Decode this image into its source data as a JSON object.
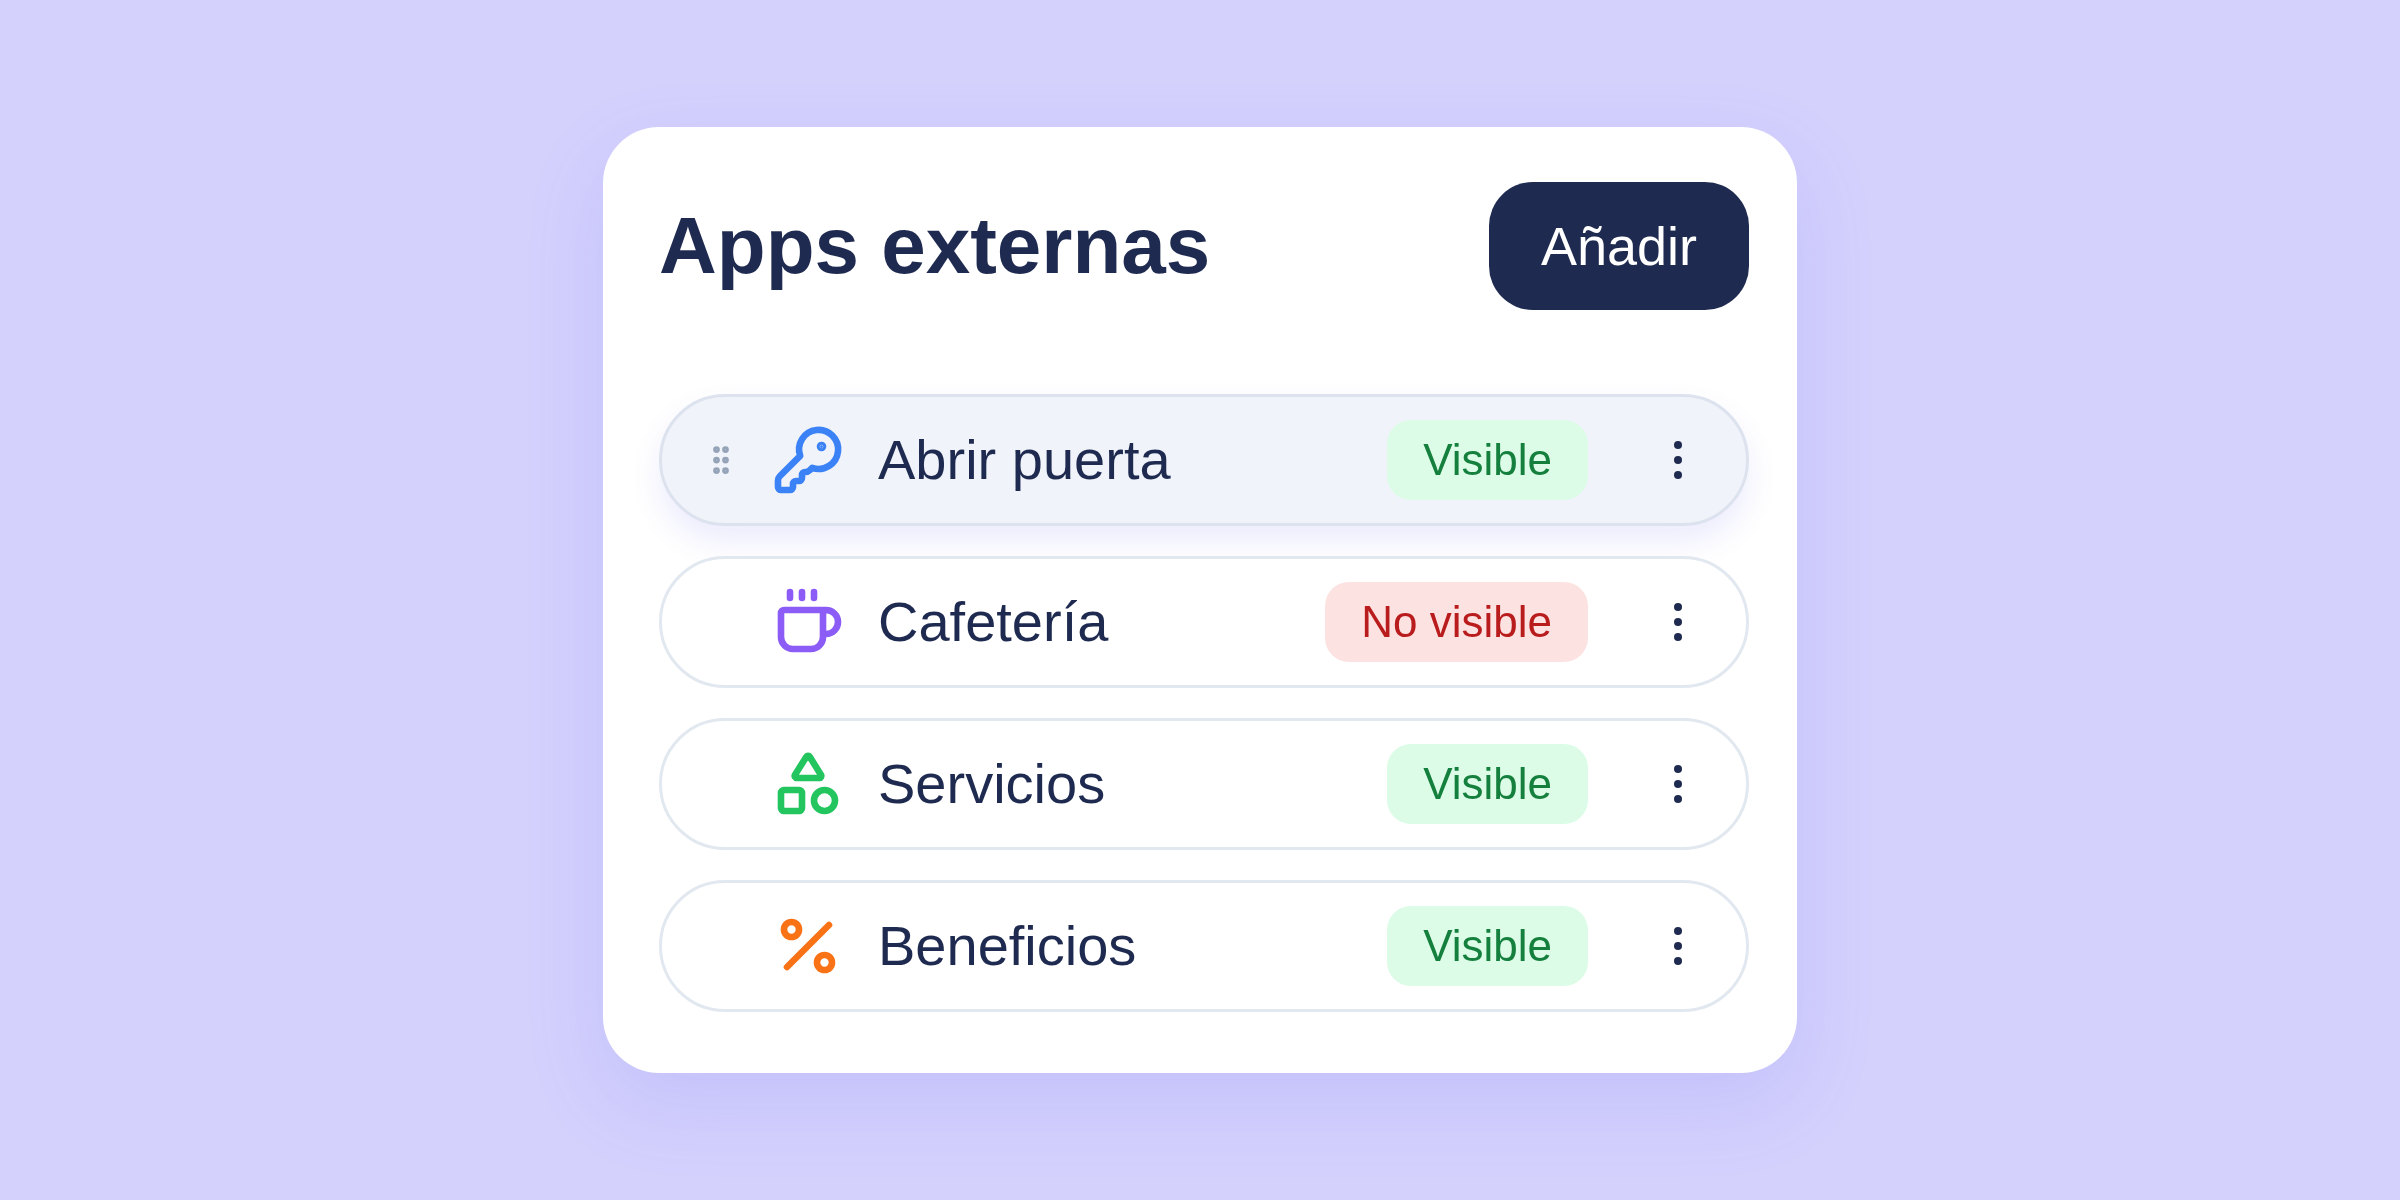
{
  "panel": {
    "title": "Apps externas",
    "add_button": "Añadir"
  },
  "apps": [
    {
      "kind": "key",
      "name": "Abrir puerta",
      "status": "Visible",
      "visible": true,
      "dragging": true
    },
    {
      "kind": "coffee",
      "name": "Cafetería",
      "status": "No visible",
      "visible": false,
      "dragging": false
    },
    {
      "kind": "shapes",
      "name": "Servicios",
      "status": "Visible",
      "visible": true,
      "dragging": false
    },
    {
      "kind": "percent",
      "name": "Beneficios",
      "status": "Visible",
      "visible": true,
      "dragging": false
    }
  ]
}
